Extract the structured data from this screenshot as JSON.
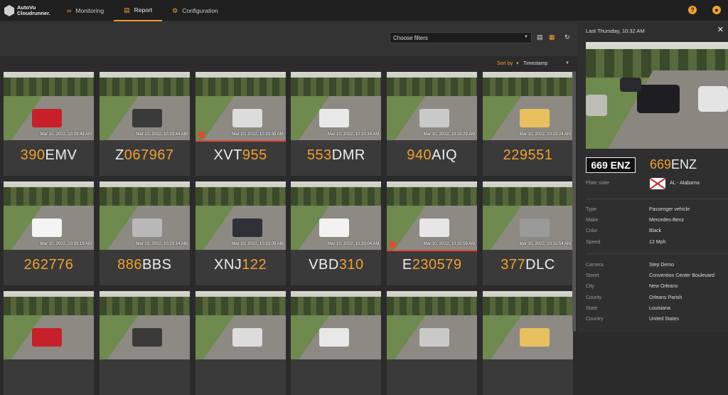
{
  "app": {
    "logo_line1": "AutoVu",
    "logo_line2": "Cloudrunner."
  },
  "nav": [
    {
      "label": "Monitoring",
      "icon": "binoculars-icon"
    },
    {
      "label": "Report",
      "icon": "report-icon",
      "active": true
    },
    {
      "label": "Configuration",
      "icon": "gear-icon"
    }
  ],
  "top_icons": [
    {
      "name": "help-icon",
      "glyph": "?"
    },
    {
      "name": "user-icon",
      "glyph": "●"
    }
  ],
  "toolbar": {
    "filter_placeholder": "Choose filters"
  },
  "sort": {
    "label": "Sort by",
    "value": "Timestamp"
  },
  "colors": {
    "accent": "#f0a030",
    "alert": "#e04a3a"
  },
  "reads": [
    {
      "timestamp": "Mar 10, 2022, 10:33:49 AM",
      "plate_a": "390",
      "plate_b": "EMV",
      "a_color": "orange",
      "hit": false
    },
    {
      "timestamp": "Mar 10, 2022, 10:33:44 AM",
      "plate_a": "Z",
      "plate_b": "067967",
      "a_color": "white",
      "hit": false
    },
    {
      "timestamp": "Mar 10, 2022, 10:33:39 AM",
      "plate_a": "XVT",
      "plate_b": "955",
      "a_color": "white",
      "hit": true
    },
    {
      "timestamp": "Mar 10, 2022, 10:33:34 AM",
      "plate_a": "553",
      "plate_b": "DMR",
      "a_color": "orange",
      "hit": false
    },
    {
      "timestamp": "Mar 10, 2022, 10:33:29 AM",
      "plate_a": "940",
      "plate_b": "AIQ",
      "a_color": "orange",
      "hit": false
    },
    {
      "timestamp": "Mar 10, 2022, 10:33:24 AM",
      "plate_a": "229551",
      "plate_b": "",
      "a_color": "orange",
      "hit": false
    },
    {
      "timestamp": "Mar 10, 2022, 10:33:19 AM",
      "plate_a": "262776",
      "plate_b": "",
      "a_color": "orange",
      "hit": false
    },
    {
      "timestamp": "Mar 10, 2022, 10:33:14 AM",
      "plate_a": "886",
      "plate_b": "BBS",
      "a_color": "orange",
      "hit": false
    },
    {
      "timestamp": "Mar 10, 2022, 10:33:09 AM",
      "plate_a": "XNJ",
      "plate_b": "122",
      "a_color": "white",
      "hit": false
    },
    {
      "timestamp": "Mar 10, 2022, 10:33:04 AM",
      "plate_a": "VBD",
      "plate_b": "310",
      "a_color": "white",
      "hit": false
    },
    {
      "timestamp": "Mar 10, 2022, 10:32:59 AM",
      "plate_a": "E",
      "plate_b": "230579",
      "a_color": "white",
      "hit": true
    },
    {
      "timestamp": "Mar 10, 2022, 10:32:54 AM",
      "plate_a": "377",
      "plate_b": "DLC",
      "a_color": "orange",
      "hit": false
    }
  ],
  "detail": {
    "title": "Last Thursday, 10:32 AM",
    "plate_crop": "669 ENZ",
    "plate_a": "669",
    "plate_b": "ENZ",
    "plate_state_label": "Plate state",
    "plate_state_value": "AL - Alabama",
    "vehicle": [
      {
        "label": "Type",
        "value": "Passenger vehicle"
      },
      {
        "label": "Make",
        "value": "Mercedes-Benz"
      },
      {
        "label": "Color",
        "value": "Black"
      },
      {
        "label": "Speed",
        "value": "12 Mph"
      }
    ],
    "location": [
      {
        "label": "Camera",
        "value": "Step Demo"
      },
      {
        "label": "Street",
        "value": "Convention Center Boulevard"
      },
      {
        "label": "City",
        "value": "New Orleans"
      },
      {
        "label": "County",
        "value": "Orleans Parish"
      },
      {
        "label": "State",
        "value": "Louisiana"
      },
      {
        "label": "Country",
        "value": "United States"
      }
    ]
  }
}
